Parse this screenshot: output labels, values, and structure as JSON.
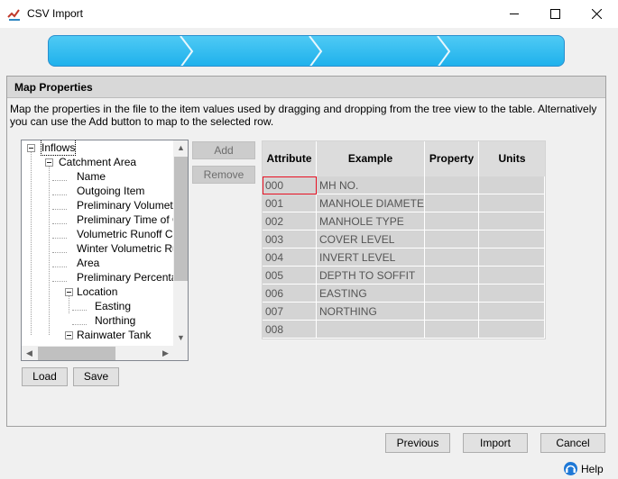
{
  "window": {
    "title": "CSV Import"
  },
  "section": {
    "title": "Map Properties",
    "description": "Map the properties in the file to the item values used by dragging and dropping from the tree view to the table. Alternatively you can use the Add button to map to the selected row."
  },
  "tree": {
    "root": "Inflows",
    "catchment": "Catchment Area",
    "catchment_children": [
      "Name",
      "Outgoing Item",
      "Preliminary Volumetric",
      "Preliminary Time of Co",
      "Volumetric Runoff Coe",
      "Winter Volumetric Run",
      "Area",
      "Preliminary Percentage"
    ],
    "location": "Location",
    "location_children": [
      "Easting",
      "Northing"
    ],
    "rainwater": "Rainwater Tank"
  },
  "buttons": {
    "add": "Add",
    "remove": "Remove",
    "load": "Load",
    "save": "Save",
    "previous": "Previous",
    "import": "Import",
    "cancel": "Cancel",
    "help": "Help"
  },
  "table": {
    "headers": [
      "Attribute",
      "Example",
      "Property",
      "Units"
    ],
    "rows": [
      {
        "attribute": "000",
        "example": "MH NO."
      },
      {
        "attribute": "001",
        "example": "MANHOLE DIAMETER"
      },
      {
        "attribute": "002",
        "example": "MANHOLE TYPE"
      },
      {
        "attribute": "003",
        "example": "COVER LEVEL"
      },
      {
        "attribute": "004",
        "example": "INVERT LEVEL"
      },
      {
        "attribute": "005",
        "example": "DEPTH TO SOFFIT"
      },
      {
        "attribute": "006",
        "example": "EASTING"
      },
      {
        "attribute": "007",
        "example": "NORTHING"
      },
      {
        "attribute": "008",
        "example": ""
      }
    ]
  },
  "colors": {
    "wizard": "#1fb1ec",
    "selection_border": "#e81123",
    "help": "#1e78d6"
  }
}
